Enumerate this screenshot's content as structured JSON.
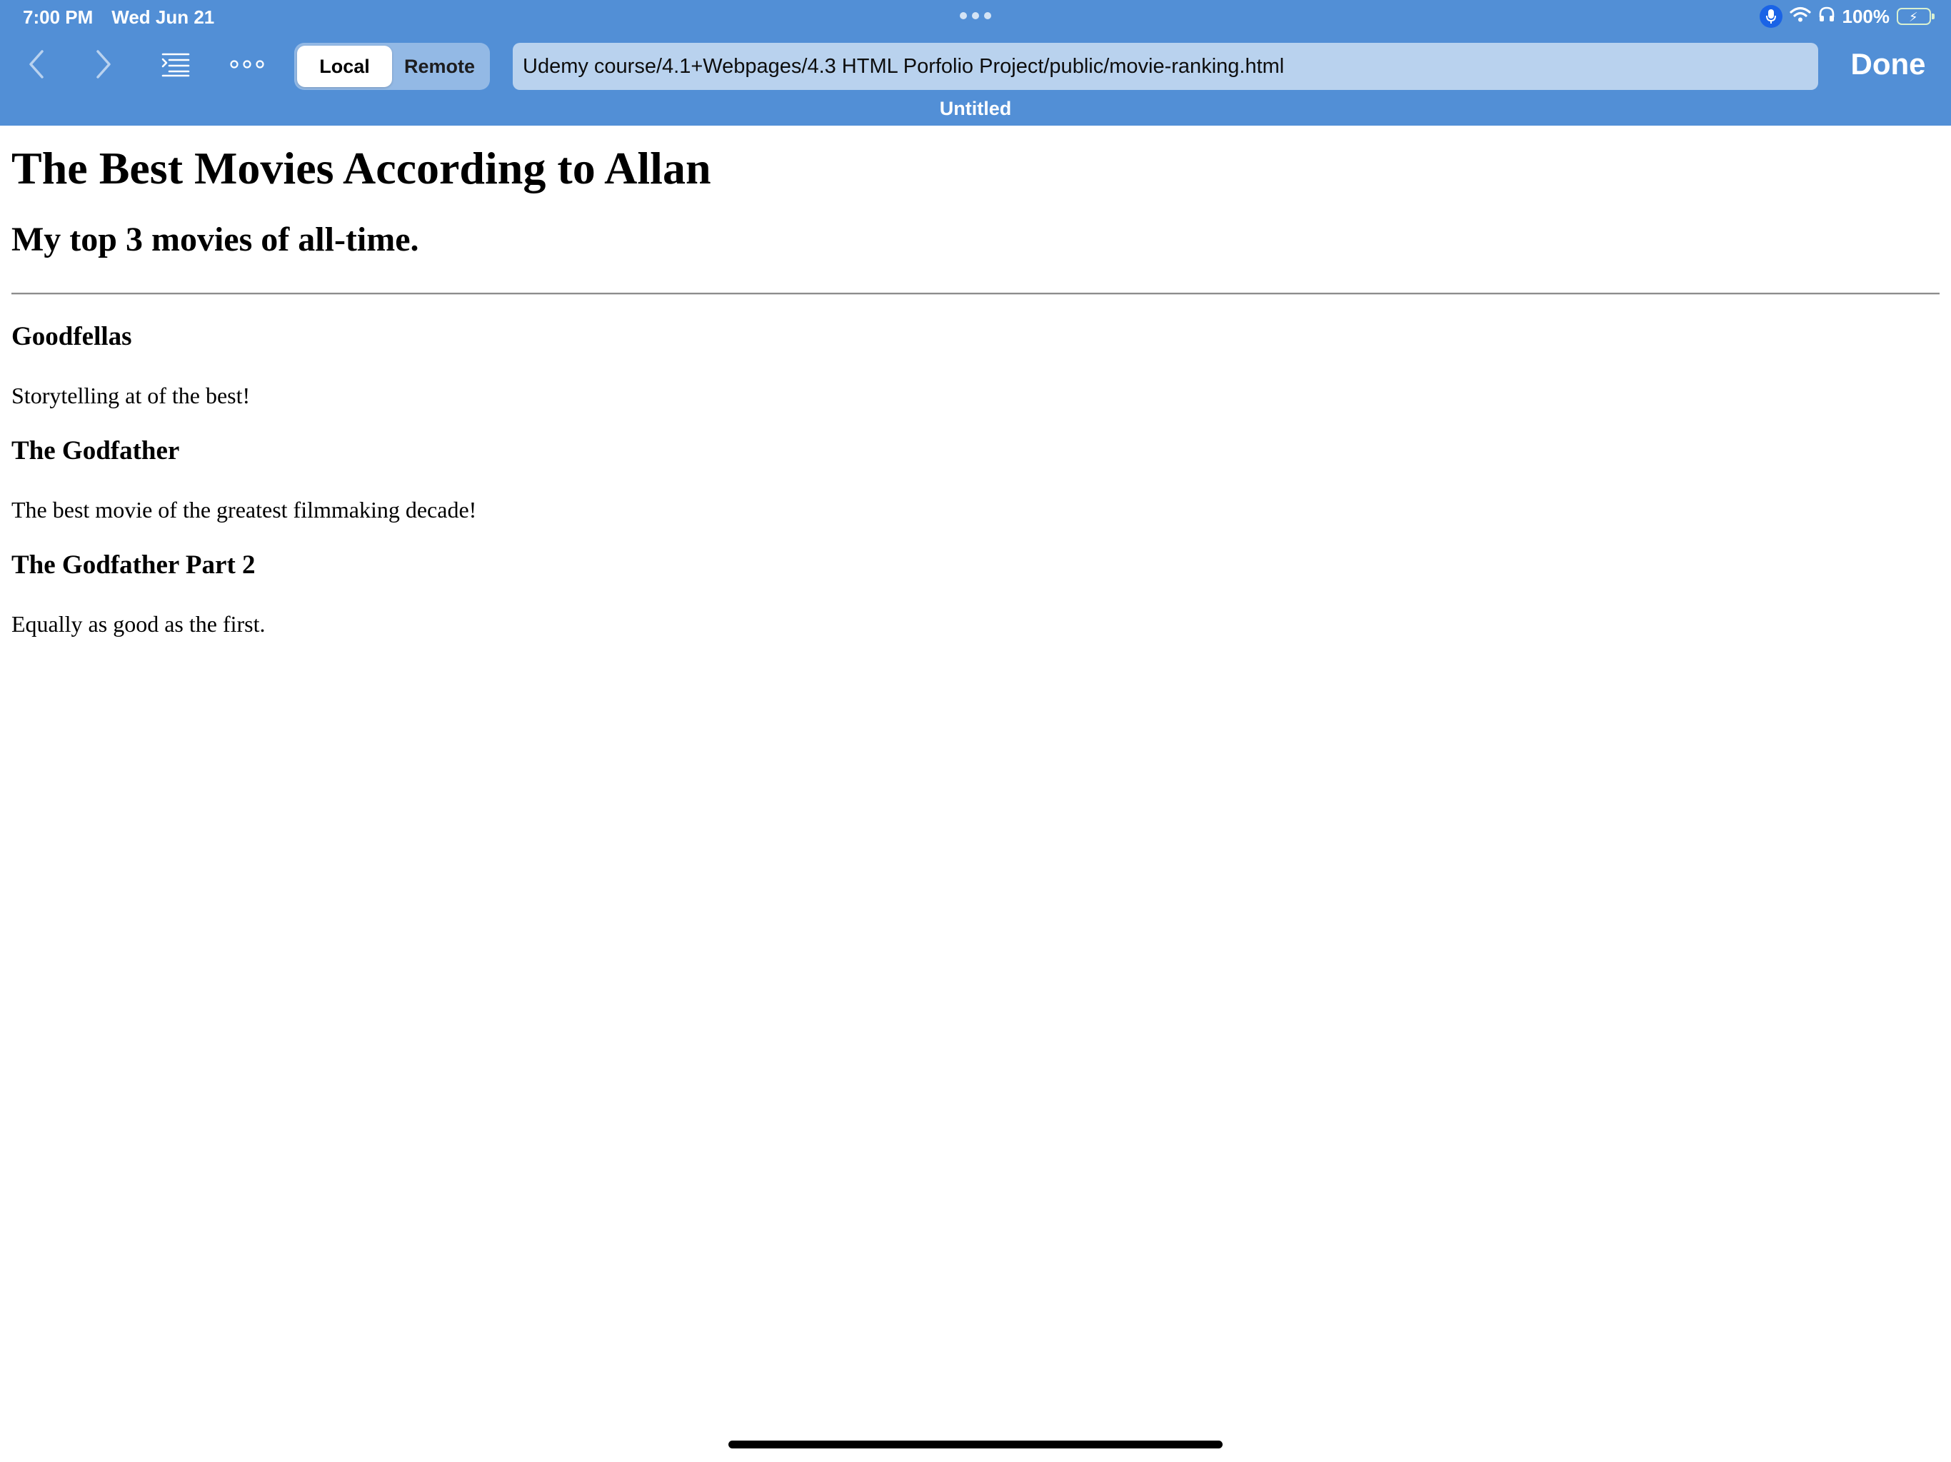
{
  "status_bar": {
    "time": "7:00 PM",
    "date": "Wed Jun 21",
    "battery_percent": "100%",
    "battery_level": 1.0,
    "charging": true
  },
  "toolbar": {
    "segments": [
      "Local",
      "Remote"
    ],
    "selected_segment": "Local",
    "url": "Udemy course/4.1+Webpages/4.3 HTML Porfolio Project/public/movie-ranking.html",
    "done_label": "Done",
    "page_title": "Untitled",
    "icons": [
      "chevron-left-icon",
      "chevron-right-icon",
      "list-indent-icon",
      "more-dots-icon"
    ]
  },
  "colors": {
    "chrome_bg": "#528fd6",
    "url_field_bg": "#b9d2ee",
    "mic_indicator": "#1a63e6",
    "battery_green": "#58d15b"
  },
  "page": {
    "heading": "The Best Movies According to Allan",
    "subheading": "My top 3 movies of all-time.",
    "movies": [
      {
        "title": "Goodfellas",
        "description": "Storytelling at of the best!"
      },
      {
        "title": "The Godfather",
        "description": "The best movie of the greatest filmmaking decade!"
      },
      {
        "title": "The Godfather Part 2",
        "description": "Equally as good as the first."
      }
    ]
  }
}
